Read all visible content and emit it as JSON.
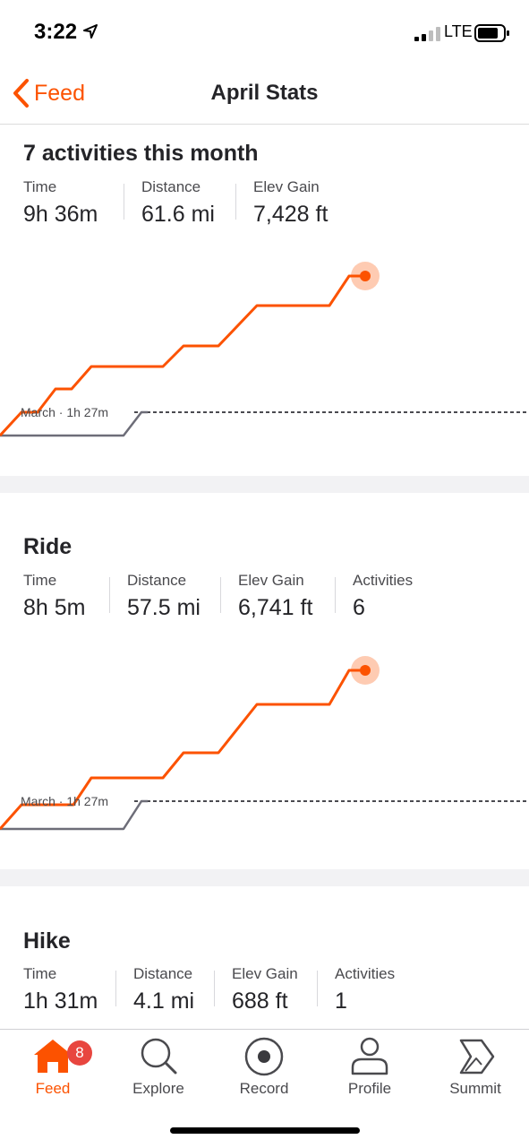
{
  "status_bar": {
    "time": "3:22",
    "network": "LTE"
  },
  "nav": {
    "back_label": "Feed",
    "title": "April Stats"
  },
  "summary": {
    "title": "7 activities this month",
    "stats": [
      {
        "label": "Time",
        "value": "9h 36m"
      },
      {
        "label": "Distance",
        "value": "61.6 mi"
      },
      {
        "label": "Elev Gain",
        "value": "7,428 ft"
      }
    ],
    "comparison_label": "March · 1h 27m"
  },
  "ride": {
    "title": "Ride",
    "stats": [
      {
        "label": "Time",
        "value": "8h 5m"
      },
      {
        "label": "Distance",
        "value": "57.5 mi"
      },
      {
        "label": "Elev Gain",
        "value": "6,741 ft"
      },
      {
        "label": "Activities",
        "value": "6"
      }
    ],
    "comparison_label": "March · 1h 27m"
  },
  "hike": {
    "title": "Hike",
    "stats": [
      {
        "label": "Time",
        "value": "1h 31m"
      },
      {
        "label": "Distance",
        "value": "4.1 mi"
      },
      {
        "label": "Elev Gain",
        "value": "688 ft"
      },
      {
        "label": "Activities",
        "value": "1"
      }
    ]
  },
  "tabs": [
    {
      "label": "Feed",
      "icon": "home-icon",
      "badge": "8",
      "active": true
    },
    {
      "label": "Explore",
      "icon": "search-icon"
    },
    {
      "label": "Record",
      "icon": "record-icon"
    },
    {
      "label": "Profile",
      "icon": "profile-icon"
    },
    {
      "label": "Summit",
      "icon": "summit-icon"
    }
  ],
  "colors": {
    "accent": "#fc5200",
    "text": "#242428",
    "muted": "#4a4a4e",
    "previous_line": "#6d6d78",
    "badge": "#e8463f"
  }
}
